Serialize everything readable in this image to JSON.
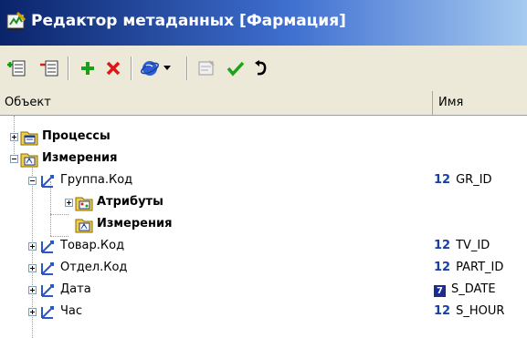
{
  "window": {
    "title": "Редактор метаданных [Фармация]"
  },
  "columns": {
    "object": "Объект",
    "name": "Имя"
  },
  "tree": {
    "processes": "Процессы",
    "measurements": "Измерения",
    "group_code": "Группа.Код",
    "attributes": "Атрибуты",
    "sub_measurements": "Измерения",
    "product_code": "Товар.Код",
    "department_code": "Отдел.Код",
    "date": "Дата",
    "hour": "Час"
  },
  "names": {
    "group_code": {
      "type": "12",
      "value": "GR_ID"
    },
    "product_code": {
      "type": "12",
      "value": "TV_ID"
    },
    "department_code": {
      "type": "12",
      "value": "PART_ID"
    },
    "date": {
      "type": "7",
      "value": "S_DATE"
    },
    "hour": {
      "type": "12",
      "value": "S_HOUR"
    }
  },
  "icons": {
    "app": "metadata-editor-icon",
    "toolbar": [
      "add-child-icon",
      "remove-icon",
      "add-icon",
      "delete-icon",
      "globe-icon",
      "dropdown-arrow-icon",
      "properties-icon",
      "check-icon",
      "undo-icon"
    ]
  },
  "colors": {
    "titlebar_start": "#0a246a",
    "titlebar_end": "#a6caf0",
    "type_badge": "#1a3ea8"
  }
}
